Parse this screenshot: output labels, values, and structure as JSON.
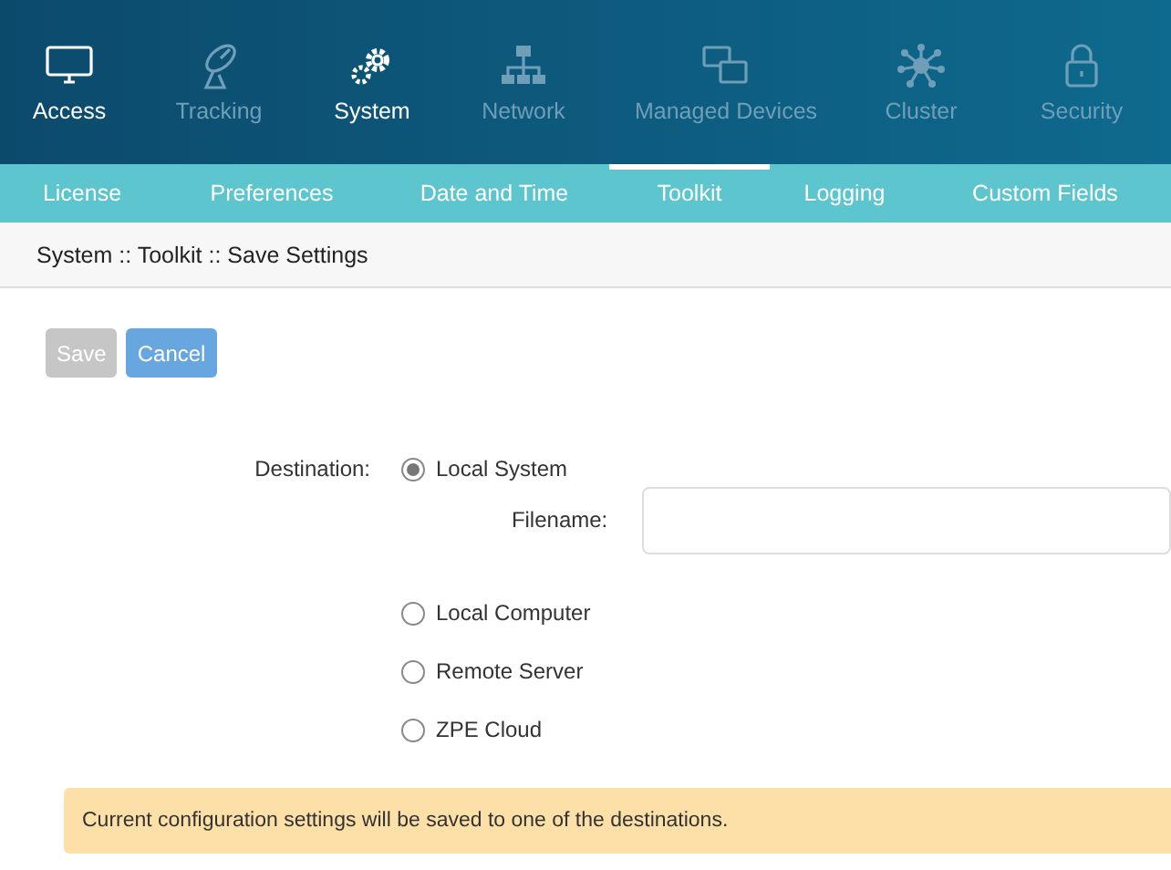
{
  "nav": [
    {
      "label": "Access",
      "highlighted": true
    },
    {
      "label": "Tracking",
      "highlighted": false
    },
    {
      "label": "System",
      "highlighted": true
    },
    {
      "label": "Network",
      "highlighted": false
    },
    {
      "label": "Managed Devices",
      "highlighted": false
    },
    {
      "label": "Cluster",
      "highlighted": false
    },
    {
      "label": "Security",
      "highlighted": false
    }
  ],
  "tabs": [
    {
      "label": "License",
      "selected": false
    },
    {
      "label": "Preferences",
      "selected": false
    },
    {
      "label": "Date and Time",
      "selected": false
    },
    {
      "label": "Toolkit",
      "selected": true
    },
    {
      "label": "Logging",
      "selected": false
    },
    {
      "label": "Custom Fields",
      "selected": false
    }
  ],
  "breadcrumb": "System :: Toolkit :: Save Settings",
  "buttons": [
    {
      "label": "Save",
      "disabled": true
    },
    {
      "label": "Cancel",
      "disabled": false
    }
  ],
  "destination": {
    "label": "Destination:",
    "filename_label": "Filename:",
    "options": [
      {
        "label": "Local System",
        "selected": true
      },
      {
        "label": "Local Computer",
        "selected": false
      },
      {
        "label": "Remote Server",
        "selected": false
      },
      {
        "label": "ZPE Cloud",
        "selected": false
      }
    ]
  },
  "notice": "Current configuration settings will be saved to one of the destinations."
}
